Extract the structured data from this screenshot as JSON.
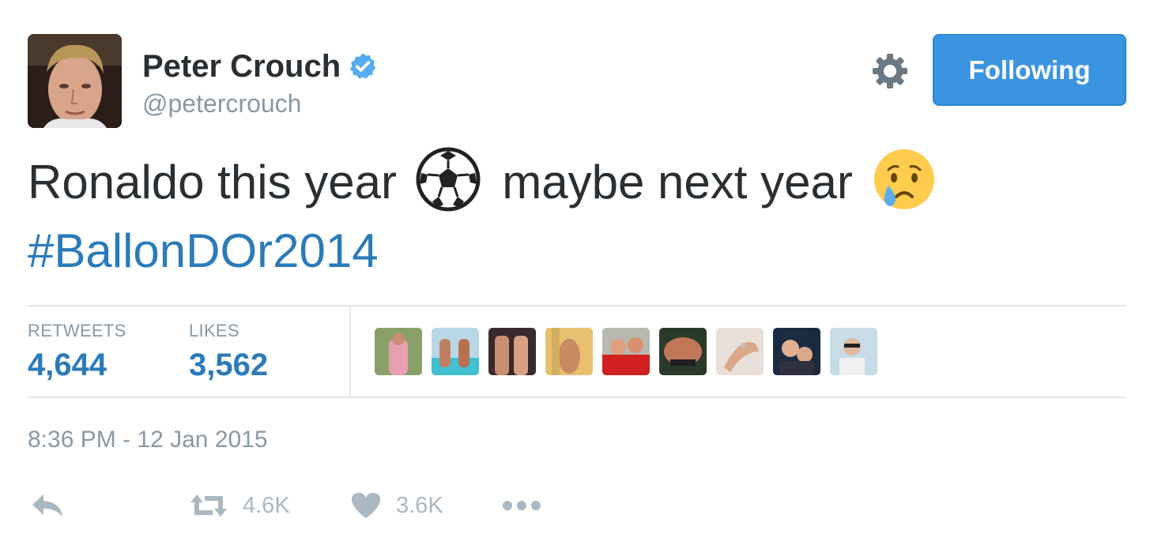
{
  "user": {
    "display_name": "Peter Crouch",
    "handle": "@petercrouch",
    "verified": true
  },
  "header": {
    "follow_label": "Following",
    "settings_icon": "gear-icon"
  },
  "tweet": {
    "text_part1": "Ronaldo this year",
    "emoji1": "soccer-ball",
    "text_part2": "maybe next year",
    "emoji2": "crying-face",
    "hashtag": "#BallonDOr2014"
  },
  "stats": {
    "retweets_label": "RETWEETS",
    "retweets_value": "4,644",
    "likes_label": "LIKES",
    "likes_value": "3,562"
  },
  "likers_count": 9,
  "timestamp": "8:36 PM - 12 Jan 2015",
  "actions": {
    "reply_icon": "reply-icon",
    "retweet_icon": "retweet-icon",
    "retweet_count": "4.6K",
    "like_icon": "heart-icon",
    "like_count": "3.6K",
    "more_icon": "more-icon"
  },
  "colors": {
    "link": "#2b7bb9",
    "button": "#3b94e0",
    "muted": "#8899a6",
    "action": "#aab8c2",
    "text": "#292f33"
  }
}
